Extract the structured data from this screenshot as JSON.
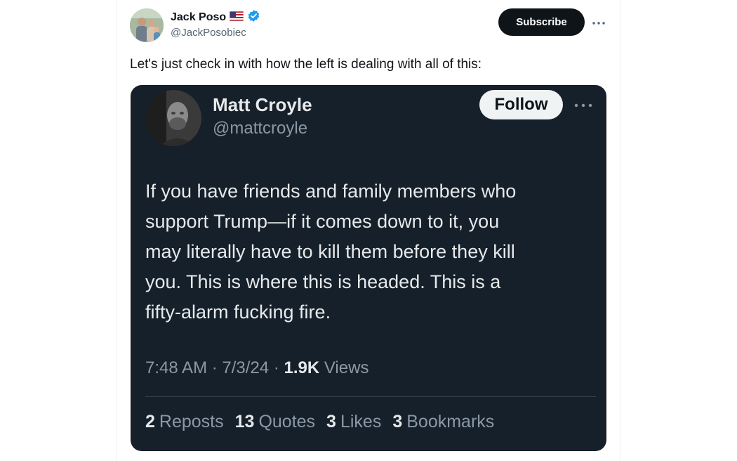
{
  "tweet": {
    "author": {
      "display_name": "Jack Poso",
      "flag_icon": "us-flag-icon",
      "verified_icon": "verified-badge-icon",
      "handle": "@JackPosobiec"
    },
    "subscribe_label": "Subscribe",
    "more_icon": "more-horizontal-icon",
    "text": "Let's just check in with how the left is dealing with all of this:",
    "colors": {
      "verified": "#1d9bf0",
      "subscribe_bg": "#0f1419",
      "text": "#0f1419",
      "secondary": "#536471"
    }
  },
  "screenshot": {
    "author": {
      "display_name": "Matt Croyle",
      "handle": "@mattcroyle"
    },
    "follow_label": "Follow",
    "body_lines": [
      "If you have friends and family members who",
      "support Trump—if it comes down to it, you",
      "may literally have to kill them before they kill",
      "you. This is where this is headed. This is a",
      "fifty-alarm fucking fire."
    ],
    "meta": {
      "time": "7:48 AM",
      "date": "7/3/24",
      "views_count": "1.9K",
      "views_label": "Views"
    },
    "stats": [
      {
        "count": "2",
        "label": "Reposts"
      },
      {
        "count": "13",
        "label": "Quotes"
      },
      {
        "count": "3",
        "label": "Likes"
      },
      {
        "count": "3",
        "label": "Bookmarks"
      }
    ],
    "colors": {
      "background": "#15202b",
      "text": "#e7e9ea",
      "secondary": "#8b98a5"
    }
  }
}
